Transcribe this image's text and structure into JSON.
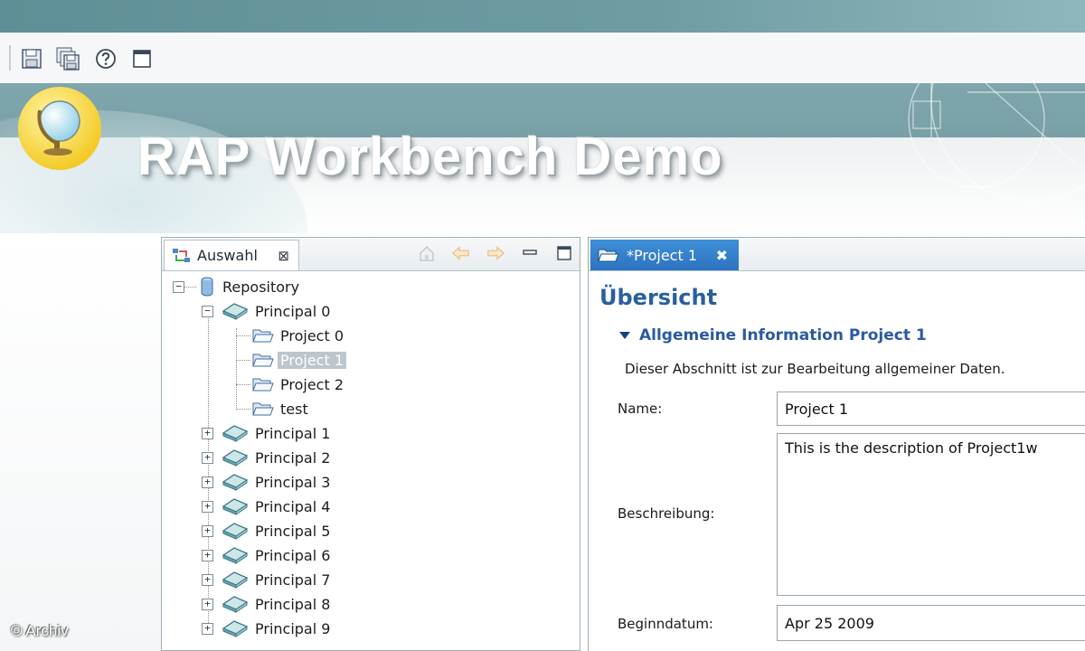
{
  "app": {
    "title": "RAP Workbench Demo"
  },
  "toolbar": {
    "buttons": [
      {
        "icon": "save-icon"
      },
      {
        "icon": "save-all-icon"
      },
      {
        "icon": "help-icon"
      },
      {
        "icon": "window-icon"
      }
    ]
  },
  "left_view": {
    "tab_label": "Auswahl",
    "tools": [
      "home-icon",
      "back-arrow-icon",
      "forward-arrow-icon",
      "minimize-icon",
      "maximize-icon"
    ],
    "tree": {
      "root": "Repository",
      "principal0": "Principal 0",
      "children": [
        "Project 0",
        "Project 1",
        "Project 2",
        "test"
      ],
      "selected": "Project 1",
      "principals": [
        "Principal 1",
        "Principal 2",
        "Principal 3",
        "Principal 4",
        "Principal 5",
        "Principal 6",
        "Principal 7",
        "Principal 8",
        "Principal 9"
      ]
    }
  },
  "editor": {
    "tab_label": "*Project 1",
    "form_title": "Übersicht",
    "section_title": "Allgemeine Information Project 1",
    "section_description": "Dieser Abschnitt ist zur Bearbeitung allgemeiner Daten.",
    "fields": {
      "name": {
        "label": "Name:",
        "value": "Project 1"
      },
      "description": {
        "label": "Beschreibung:",
        "value": "This is the description of Project1w"
      },
      "start_date": {
        "label": "Beginndatum:",
        "value": "Apr 25 2009"
      }
    }
  },
  "watermark": "© Archiv",
  "colors": {
    "accent": "#2c73c0",
    "banner": "#7ea6ac",
    "section": "#2b5aa0"
  }
}
